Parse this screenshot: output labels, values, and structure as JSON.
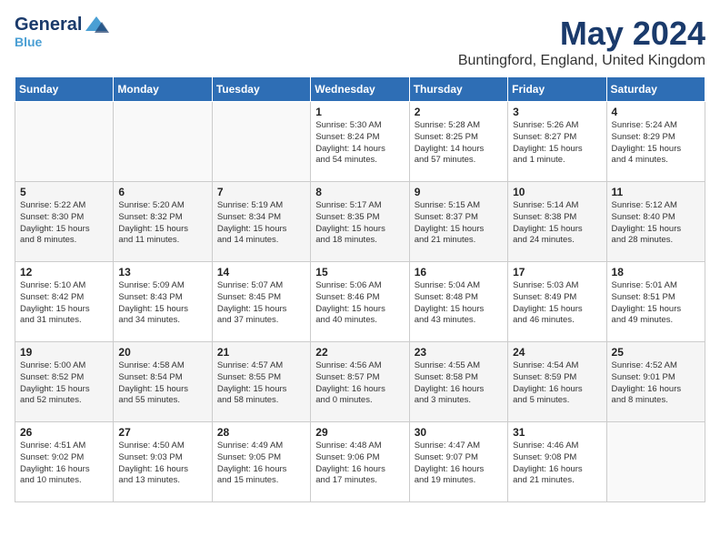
{
  "header": {
    "logo_general": "General",
    "logo_blue": "Blue",
    "month_year": "May 2024",
    "location": "Buntingford, England, United Kingdom"
  },
  "days_of_week": [
    "Sunday",
    "Monday",
    "Tuesday",
    "Wednesday",
    "Thursday",
    "Friday",
    "Saturday"
  ],
  "weeks": [
    [
      {
        "day": "",
        "content": ""
      },
      {
        "day": "",
        "content": ""
      },
      {
        "day": "",
        "content": ""
      },
      {
        "day": "1",
        "content": "Sunrise: 5:30 AM\nSunset: 8:24 PM\nDaylight: 14 hours\nand 54 minutes."
      },
      {
        "day": "2",
        "content": "Sunrise: 5:28 AM\nSunset: 8:25 PM\nDaylight: 14 hours\nand 57 minutes."
      },
      {
        "day": "3",
        "content": "Sunrise: 5:26 AM\nSunset: 8:27 PM\nDaylight: 15 hours\nand 1 minute."
      },
      {
        "day": "4",
        "content": "Sunrise: 5:24 AM\nSunset: 8:29 PM\nDaylight: 15 hours\nand 4 minutes."
      }
    ],
    [
      {
        "day": "5",
        "content": "Sunrise: 5:22 AM\nSunset: 8:30 PM\nDaylight: 15 hours\nand 8 minutes."
      },
      {
        "day": "6",
        "content": "Sunrise: 5:20 AM\nSunset: 8:32 PM\nDaylight: 15 hours\nand 11 minutes."
      },
      {
        "day": "7",
        "content": "Sunrise: 5:19 AM\nSunset: 8:34 PM\nDaylight: 15 hours\nand 14 minutes."
      },
      {
        "day": "8",
        "content": "Sunrise: 5:17 AM\nSunset: 8:35 PM\nDaylight: 15 hours\nand 18 minutes."
      },
      {
        "day": "9",
        "content": "Sunrise: 5:15 AM\nSunset: 8:37 PM\nDaylight: 15 hours\nand 21 minutes."
      },
      {
        "day": "10",
        "content": "Sunrise: 5:14 AM\nSunset: 8:38 PM\nDaylight: 15 hours\nand 24 minutes."
      },
      {
        "day": "11",
        "content": "Sunrise: 5:12 AM\nSunset: 8:40 PM\nDaylight: 15 hours\nand 28 minutes."
      }
    ],
    [
      {
        "day": "12",
        "content": "Sunrise: 5:10 AM\nSunset: 8:42 PM\nDaylight: 15 hours\nand 31 minutes."
      },
      {
        "day": "13",
        "content": "Sunrise: 5:09 AM\nSunset: 8:43 PM\nDaylight: 15 hours\nand 34 minutes."
      },
      {
        "day": "14",
        "content": "Sunrise: 5:07 AM\nSunset: 8:45 PM\nDaylight: 15 hours\nand 37 minutes."
      },
      {
        "day": "15",
        "content": "Sunrise: 5:06 AM\nSunset: 8:46 PM\nDaylight: 15 hours\nand 40 minutes."
      },
      {
        "day": "16",
        "content": "Sunrise: 5:04 AM\nSunset: 8:48 PM\nDaylight: 15 hours\nand 43 minutes."
      },
      {
        "day": "17",
        "content": "Sunrise: 5:03 AM\nSunset: 8:49 PM\nDaylight: 15 hours\nand 46 minutes."
      },
      {
        "day": "18",
        "content": "Sunrise: 5:01 AM\nSunset: 8:51 PM\nDaylight: 15 hours\nand 49 minutes."
      }
    ],
    [
      {
        "day": "19",
        "content": "Sunrise: 5:00 AM\nSunset: 8:52 PM\nDaylight: 15 hours\nand 52 minutes."
      },
      {
        "day": "20",
        "content": "Sunrise: 4:58 AM\nSunset: 8:54 PM\nDaylight: 15 hours\nand 55 minutes."
      },
      {
        "day": "21",
        "content": "Sunrise: 4:57 AM\nSunset: 8:55 PM\nDaylight: 15 hours\nand 58 minutes."
      },
      {
        "day": "22",
        "content": "Sunrise: 4:56 AM\nSunset: 8:57 PM\nDaylight: 16 hours\nand 0 minutes."
      },
      {
        "day": "23",
        "content": "Sunrise: 4:55 AM\nSunset: 8:58 PM\nDaylight: 16 hours\nand 3 minutes."
      },
      {
        "day": "24",
        "content": "Sunrise: 4:54 AM\nSunset: 8:59 PM\nDaylight: 16 hours\nand 5 minutes."
      },
      {
        "day": "25",
        "content": "Sunrise: 4:52 AM\nSunset: 9:01 PM\nDaylight: 16 hours\nand 8 minutes."
      }
    ],
    [
      {
        "day": "26",
        "content": "Sunrise: 4:51 AM\nSunset: 9:02 PM\nDaylight: 16 hours\nand 10 minutes."
      },
      {
        "day": "27",
        "content": "Sunrise: 4:50 AM\nSunset: 9:03 PM\nDaylight: 16 hours\nand 13 minutes."
      },
      {
        "day": "28",
        "content": "Sunrise: 4:49 AM\nSunset: 9:05 PM\nDaylight: 16 hours\nand 15 minutes."
      },
      {
        "day": "29",
        "content": "Sunrise: 4:48 AM\nSunset: 9:06 PM\nDaylight: 16 hours\nand 17 minutes."
      },
      {
        "day": "30",
        "content": "Sunrise: 4:47 AM\nSunset: 9:07 PM\nDaylight: 16 hours\nand 19 minutes."
      },
      {
        "day": "31",
        "content": "Sunrise: 4:46 AM\nSunset: 9:08 PM\nDaylight: 16 hours\nand 21 minutes."
      },
      {
        "day": "",
        "content": ""
      }
    ]
  ]
}
